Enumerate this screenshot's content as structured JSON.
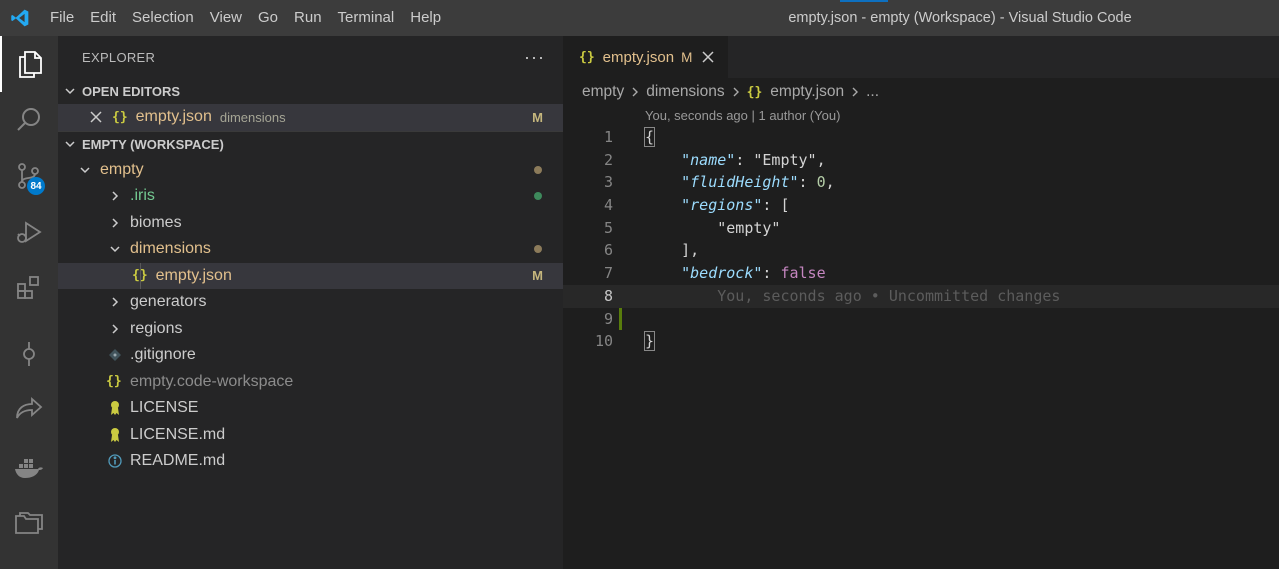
{
  "titlebar": {
    "menu": [
      "File",
      "Edit",
      "Selection",
      "View",
      "Go",
      "Run",
      "Terminal",
      "Help"
    ],
    "window_title": "empty.json - empty (Workspace) - Visual Studio Code"
  },
  "activitybar": {
    "items": [
      "explorer-icon",
      "search-icon",
      "source-control-icon",
      "run-debug-icon",
      "extensions-icon",
      "git-graph-icon",
      "remote-share-icon",
      "docker-icon",
      "folder-icon"
    ],
    "scm_badge": "84"
  },
  "sidebar": {
    "title": "EXPLORER",
    "more": "···",
    "open_editors": {
      "label": "OPEN EDITORS",
      "items": [
        {
          "name": "empty.json",
          "description": "dimensions",
          "status": "M"
        }
      ]
    },
    "workspace": {
      "label": "EMPTY (WORKSPACE)",
      "tree": [
        {
          "name": "empty",
          "kind": "folder-open",
          "color": "#e2c08d",
          "indicator": "dot-brown"
        },
        {
          "name": ".iris",
          "kind": "folder",
          "color": "#73c991",
          "indicator": "dot-green"
        },
        {
          "name": "biomes",
          "kind": "folder",
          "color": "#cccccc"
        },
        {
          "name": "dimensions",
          "kind": "folder-open",
          "color": "#e2c08d",
          "indicator": "dot-brown"
        },
        {
          "name": "empty.json",
          "kind": "json-file",
          "color": "#e2c08d",
          "status": "M"
        },
        {
          "name": "generators",
          "kind": "folder",
          "color": "#cccccc"
        },
        {
          "name": "regions",
          "kind": "folder",
          "color": "#cccccc"
        },
        {
          "name": ".gitignore",
          "kind": "git-file",
          "color": "#cccccc"
        },
        {
          "name": "empty.code-workspace",
          "kind": "json-file",
          "color": "#8c8c8c"
        },
        {
          "name": "LICENSE",
          "kind": "license-file",
          "color": "#cccccc"
        },
        {
          "name": "LICENSE.md",
          "kind": "license-file",
          "color": "#cccccc"
        },
        {
          "name": "README.md",
          "kind": "info-file",
          "color": "#cccccc"
        }
      ]
    }
  },
  "editor": {
    "tab": {
      "name": "empty.json",
      "modified": "M"
    },
    "breadcrumbs": [
      "empty",
      "dimensions",
      "empty.json",
      "..."
    ],
    "codelens": "You, seconds ago | 1 author (You)",
    "lines": [
      {
        "num": "1",
        "text": "{"
      },
      {
        "num": "2",
        "key": "\"name\"",
        "sep": ": ",
        "value": "\"Empty\"",
        "vtype": "str",
        "tail": ","
      },
      {
        "num": "3",
        "key": "\"fluidHeight\"",
        "sep": ": ",
        "value": "0",
        "vtype": "num",
        "tail": ","
      },
      {
        "num": "4",
        "key": "\"regions\"",
        "sep": ": ",
        "value": "[",
        "vtype": "str",
        "tail": ""
      },
      {
        "num": "5",
        "text": "        \"empty\""
      },
      {
        "num": "6",
        "text": "    ],"
      },
      {
        "num": "7",
        "key": "\"bedrock\"",
        "sep": ": ",
        "value": "false",
        "vtype": "kw",
        "tail": ""
      },
      {
        "num": "8",
        "ghost": "You, seconds ago • Uncommitted changes"
      },
      {
        "num": "9",
        "text": ""
      },
      {
        "num": "10",
        "text": "}"
      }
    ],
    "current_line": "8"
  },
  "colors": {
    "accent": "#007acc",
    "modified": "#e2c08d",
    "untracked": "#73c991",
    "json_icon": "#cbcb41"
  }
}
